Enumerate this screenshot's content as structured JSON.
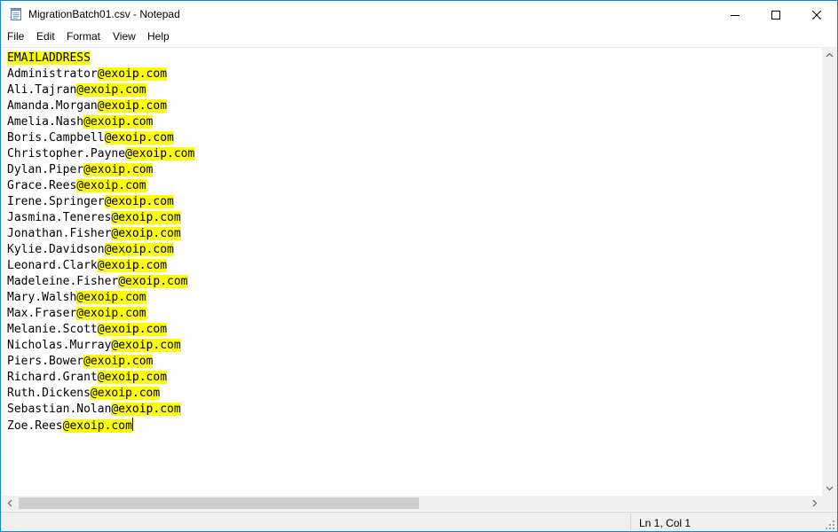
{
  "window": {
    "title": "MigrationBatch01.csv - Notepad",
    "accent_color": "#1883d7",
    "icons": {
      "app": "notepad-icon",
      "minimize": "minimize-icon",
      "maximize": "maximize-icon",
      "close": "close-icon"
    }
  },
  "menu": {
    "file": "File",
    "edit": "Edit",
    "format": "Format",
    "view": "View",
    "help": "Help"
  },
  "editor": {
    "highlight_color": "#ffff00",
    "lines": [
      {
        "name": "",
        "hl": "EMAILADDRESS"
      },
      {
        "name": "Administrator",
        "hl": "@exoip.com"
      },
      {
        "name": "Ali.Tajran",
        "hl": "@exoip.com"
      },
      {
        "name": "Amanda.Morgan",
        "hl": "@exoip.com"
      },
      {
        "name": "Amelia.Nash",
        "hl": "@exoip.com"
      },
      {
        "name": "Boris.Campbell",
        "hl": "@exoip.com"
      },
      {
        "name": "Christopher.Payne",
        "hl": "@exoip.com"
      },
      {
        "name": "Dylan.Piper",
        "hl": "@exoip.com"
      },
      {
        "name": "Grace.Rees",
        "hl": "@exoip.com"
      },
      {
        "name": "Irene.Springer",
        "hl": "@exoip.com"
      },
      {
        "name": "Jasmina.Teneres",
        "hl": "@exoip.com"
      },
      {
        "name": "Jonathan.Fisher",
        "hl": "@exoip.com"
      },
      {
        "name": "Kylie.Davidson",
        "hl": "@exoip.com"
      },
      {
        "name": "Leonard.Clark",
        "hl": "@exoip.com"
      },
      {
        "name": "Madeleine.Fisher",
        "hl": "@exoip.com"
      },
      {
        "name": "Mary.Walsh",
        "hl": "@exoip.com"
      },
      {
        "name": "Max.Fraser",
        "hl": "@exoip.com"
      },
      {
        "name": "Melanie.Scott",
        "hl": "@exoip.com"
      },
      {
        "name": "Nicholas.Murray",
        "hl": "@exoip.com"
      },
      {
        "name": "Piers.Bower",
        "hl": "@exoip.com"
      },
      {
        "name": "Richard.Grant",
        "hl": "@exoip.com"
      },
      {
        "name": "Ruth.Dickens",
        "hl": "@exoip.com"
      },
      {
        "name": "Sebastian.Nolan",
        "hl": "@exoip.com"
      },
      {
        "name": "Zoe.Rees",
        "hl": "@exoip.com"
      }
    ]
  },
  "status": {
    "position": "Ln 1, Col 1"
  }
}
